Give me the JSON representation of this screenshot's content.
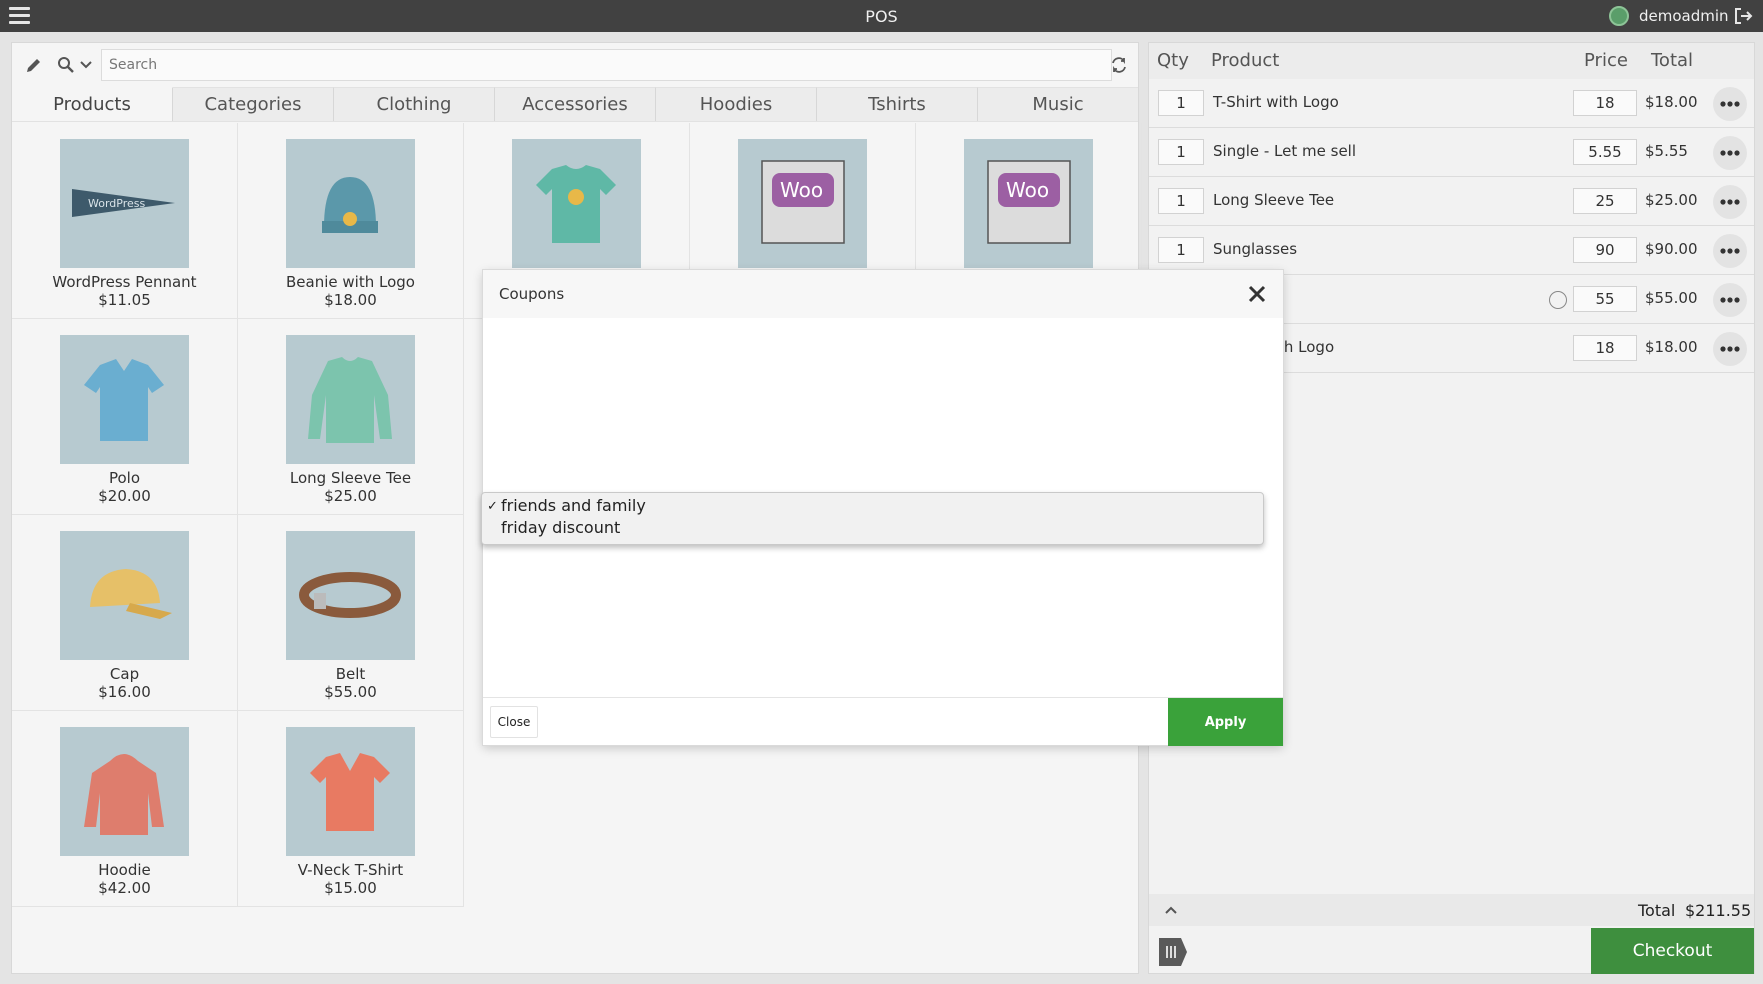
{
  "header": {
    "title": "POS",
    "user": "demoadmin"
  },
  "search": {
    "placeholder": "Search"
  },
  "tabs": [
    {
      "label": "Products"
    },
    {
      "label": "Categories"
    },
    {
      "label": "Clothing"
    },
    {
      "label": "Accessories"
    },
    {
      "label": "Hoodies"
    },
    {
      "label": "Tshirts"
    },
    {
      "label": "Music"
    }
  ],
  "products": [
    {
      "name": "WordPress Pennant",
      "price": "$11.05"
    },
    {
      "name": "Beanie with Logo",
      "price": "$18.00"
    },
    {
      "name": "",
      "price": ""
    },
    {
      "name": "",
      "price": ""
    },
    {
      "name": "",
      "price": ""
    },
    {
      "name": "Polo",
      "price": "$20.00"
    },
    {
      "name": "Long Sleeve Tee",
      "price": "$25.00"
    },
    {
      "name": "Cap",
      "price": "$16.00"
    },
    {
      "name": "Belt",
      "price": "$55.00"
    },
    {
      "name": "Hoodie",
      "price": "$42.00"
    },
    {
      "name": "V-Neck T-Shirt",
      "price": "$15.00"
    }
  ],
  "cart": {
    "headers": {
      "qty": "Qty",
      "product": "Product",
      "price": "Price",
      "total": "Total"
    },
    "rows": [
      {
        "qty": "1",
        "name": "T-Shirt with Logo",
        "price": "18",
        "total": "$18.00"
      },
      {
        "qty": "1",
        "name": "Single - Let me sell",
        "price": "5.55",
        "total": "$5.55"
      },
      {
        "qty": "1",
        "name": "Long Sleeve Tee",
        "price": "25",
        "total": "$25.00"
      },
      {
        "qty": "1",
        "name": "Sunglasses",
        "price": "90",
        "total": "$90.00"
      },
      {
        "qty": "",
        "name": "",
        "price": "55",
        "total": "$55.00"
      },
      {
        "qty": "",
        "name": "th Logo",
        "price": "18",
        "total": "$18.00"
      }
    ],
    "total_label": "Total",
    "total_value": "$211.55",
    "checkout_label": "Checkout"
  },
  "modal": {
    "title": "Coupons",
    "options": [
      {
        "label": "friends and family",
        "selected": true
      },
      {
        "label": "friday discount",
        "selected": false
      }
    ],
    "close_label": "Close",
    "apply_label": "Apply"
  },
  "colors": {
    "topbar": "#414141",
    "checkout": "#3e8f3e",
    "apply": "#3aa23a"
  }
}
